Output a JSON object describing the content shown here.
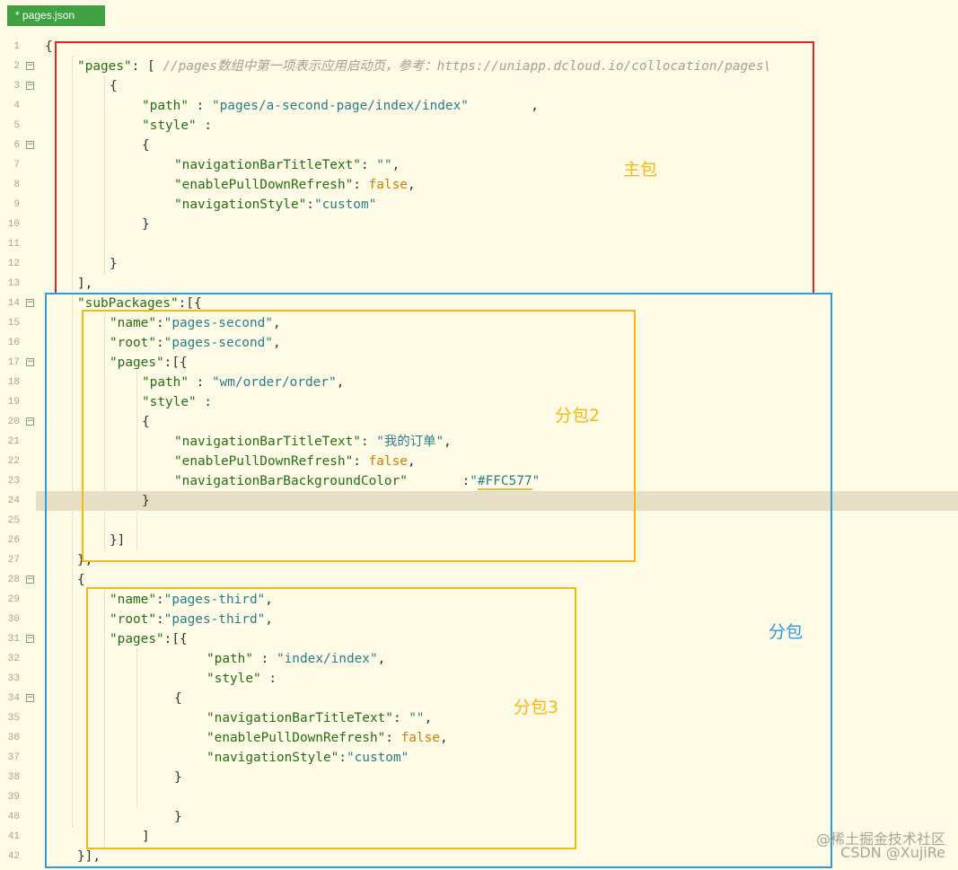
{
  "tab": {
    "title": "* pages.json"
  },
  "lines": [
    {
      "num": "1",
      "fold": false,
      "indent": 0,
      "tokens": [
        {
          "t": "{",
          "c": "p"
        }
      ]
    },
    {
      "num": "2",
      "fold": true,
      "indent": 1,
      "tokens": [
        {
          "t": "\"pages\"",
          "c": "k"
        },
        {
          "t": ": [ ",
          "c": "p"
        },
        {
          "t": "//pages数组中第一项表示应用启动页，参考：https://uniapp.dcloud.io/collocation/pages\\",
          "c": "c"
        }
      ]
    },
    {
      "num": "3",
      "fold": true,
      "indent": 2,
      "tokens": [
        {
          "t": "{",
          "c": "p"
        }
      ]
    },
    {
      "num": "4",
      "fold": false,
      "indent": 3,
      "tokens": [
        {
          "t": "\"path\"",
          "c": "k"
        },
        {
          "t": " : ",
          "c": "p"
        },
        {
          "t": "\"pages/a-second-page/index/index\"",
          "c": "s"
        },
        {
          "t": "        ,",
          "c": "p"
        }
      ]
    },
    {
      "num": "5",
      "fold": false,
      "indent": 3,
      "tokens": [
        {
          "t": "\"style\"",
          "c": "k"
        },
        {
          "t": " :",
          "c": "p"
        }
      ]
    },
    {
      "num": "6",
      "fold": true,
      "indent": 3,
      "tokens": [
        {
          "t": "{",
          "c": "p"
        }
      ]
    },
    {
      "num": "7",
      "fold": false,
      "indent": 4,
      "tokens": [
        {
          "t": "\"navigationBarTitleText\"",
          "c": "k"
        },
        {
          "t": ": ",
          "c": "p"
        },
        {
          "t": "\"\"",
          "c": "s"
        },
        {
          "t": ",",
          "c": "p"
        }
      ]
    },
    {
      "num": "8",
      "fold": false,
      "indent": 4,
      "tokens": [
        {
          "t": "\"enablePullDownRefresh\"",
          "c": "k"
        },
        {
          "t": ": ",
          "c": "p"
        },
        {
          "t": "false",
          "c": "b"
        },
        {
          "t": ",",
          "c": "p"
        }
      ]
    },
    {
      "num": "9",
      "fold": false,
      "indent": 4,
      "tokens": [
        {
          "t": "\"navigationStyle\"",
          "c": "k"
        },
        {
          "t": ":",
          "c": "p"
        },
        {
          "t": "\"custom\"",
          "c": "s"
        }
      ]
    },
    {
      "num": "10",
      "fold": false,
      "indent": 3,
      "tokens": [
        {
          "t": "}",
          "c": "p"
        }
      ]
    },
    {
      "num": "11",
      "fold": false,
      "indent": 0,
      "tokens": []
    },
    {
      "num": "12",
      "fold": false,
      "indent": 2,
      "tokens": [
        {
          "t": "}",
          "c": "p"
        }
      ]
    },
    {
      "num": "13",
      "fold": false,
      "indent": 1,
      "tokens": [
        {
          "t": "],",
          "c": "p"
        }
      ]
    },
    {
      "num": "14",
      "fold": true,
      "indent": 1,
      "tokens": [
        {
          "t": "\"subPackages\"",
          "c": "k"
        },
        {
          "t": ":[{",
          "c": "p"
        }
      ]
    },
    {
      "num": "15",
      "fold": false,
      "indent": 2,
      "tokens": [
        {
          "t": "\"name\"",
          "c": "k"
        },
        {
          "t": ":",
          "c": "p"
        },
        {
          "t": "\"pages-second\"",
          "c": "s"
        },
        {
          "t": ",",
          "c": "p"
        }
      ]
    },
    {
      "num": "16",
      "fold": false,
      "indent": 2,
      "tokens": [
        {
          "t": "\"root\"",
          "c": "k"
        },
        {
          "t": ":",
          "c": "p"
        },
        {
          "t": "\"pages-second\"",
          "c": "s"
        },
        {
          "t": ",",
          "c": "p"
        }
      ]
    },
    {
      "num": "17",
      "fold": true,
      "indent": 2,
      "tokens": [
        {
          "t": "\"pages\"",
          "c": "k"
        },
        {
          "t": ":[{",
          "c": "p"
        }
      ]
    },
    {
      "num": "18",
      "fold": false,
      "indent": 3,
      "tokens": [
        {
          "t": "\"path\"",
          "c": "k"
        },
        {
          "t": " : ",
          "c": "p"
        },
        {
          "t": "\"wm/order/order\"",
          "c": "s"
        },
        {
          "t": ",",
          "c": "p"
        }
      ]
    },
    {
      "num": "19",
      "fold": false,
      "indent": 3,
      "tokens": [
        {
          "t": "\"style\"",
          "c": "k"
        },
        {
          "t": " :",
          "c": "p"
        }
      ]
    },
    {
      "num": "20",
      "fold": true,
      "indent": 3,
      "tokens": [
        {
          "t": "{",
          "c": "p"
        }
      ]
    },
    {
      "num": "21",
      "fold": false,
      "indent": 4,
      "tokens": [
        {
          "t": "\"navigationBarTitleText\"",
          "c": "k"
        },
        {
          "t": ": ",
          "c": "p"
        },
        {
          "t": "\"我的订单\"",
          "c": "s"
        },
        {
          "t": ",",
          "c": "p"
        }
      ]
    },
    {
      "num": "22",
      "fold": false,
      "indent": 4,
      "tokens": [
        {
          "t": "\"enablePullDownRefresh\"",
          "c": "k"
        },
        {
          "t": ": ",
          "c": "p"
        },
        {
          "t": "false",
          "c": "b"
        },
        {
          "t": ",",
          "c": "p"
        }
      ]
    },
    {
      "num": "23",
      "fold": false,
      "indent": 4,
      "tokens": [
        {
          "t": "\"navigationBarBackgroundColor\"",
          "c": "k"
        },
        {
          "t": "       :",
          "c": "p"
        },
        {
          "t": "\"",
          "c": "s"
        },
        {
          "t": "#FFC577",
          "c": "hl"
        },
        {
          "t": "\"",
          "c": "s"
        }
      ]
    },
    {
      "num": "24",
      "fold": false,
      "indent": 3,
      "active": true,
      "tokens": [
        {
          "t": "}",
          "c": "p"
        }
      ]
    },
    {
      "num": "25",
      "fold": false,
      "indent": 0,
      "tokens": []
    },
    {
      "num": "26",
      "fold": false,
      "indent": 2,
      "tokens": [
        {
          "t": "}]",
          "c": "p"
        }
      ]
    },
    {
      "num": "27",
      "fold": false,
      "indent": 1,
      "tokens": [
        {
          "t": "},",
          "c": "p"
        }
      ]
    },
    {
      "num": "28",
      "fold": true,
      "indent": 1,
      "tokens": [
        {
          "t": "{",
          "c": "p"
        }
      ]
    },
    {
      "num": "29",
      "fold": false,
      "indent": 2,
      "tokens": [
        {
          "t": "\"name\"",
          "c": "k"
        },
        {
          "t": ":",
          "c": "p"
        },
        {
          "t": "\"pages-third\"",
          "c": "s"
        },
        {
          "t": ",",
          "c": "p"
        }
      ]
    },
    {
      "num": "30",
      "fold": false,
      "indent": 2,
      "tokens": [
        {
          "t": "\"root\"",
          "c": "k"
        },
        {
          "t": ":",
          "c": "p"
        },
        {
          "t": "\"pages-third\"",
          "c": "s"
        },
        {
          "t": ",",
          "c": "p"
        }
      ]
    },
    {
      "num": "31",
      "fold": true,
      "indent": 2,
      "tokens": [
        {
          "t": "\"pages\"",
          "c": "k"
        },
        {
          "t": ":[{",
          "c": "p"
        }
      ]
    },
    {
      "num": "32",
      "fold": false,
      "indent": 5,
      "tokens": [
        {
          "t": "\"path\"",
          "c": "k"
        },
        {
          "t": " : ",
          "c": "p"
        },
        {
          "t": "\"index/index\"",
          "c": "s"
        },
        {
          "t": ",",
          "c": "p"
        }
      ]
    },
    {
      "num": "33",
      "fold": false,
      "indent": 5,
      "tokens": [
        {
          "t": "\"style\"",
          "c": "k"
        },
        {
          "t": " :",
          "c": "p"
        }
      ]
    },
    {
      "num": "34",
      "fold": true,
      "indent": 4,
      "tokens": [
        {
          "t": "{",
          "c": "p"
        }
      ]
    },
    {
      "num": "35",
      "fold": false,
      "indent": 5,
      "tokens": [
        {
          "t": "\"navigationBarTitleText\"",
          "c": "k"
        },
        {
          "t": ": ",
          "c": "p"
        },
        {
          "t": "\"\"",
          "c": "s"
        },
        {
          "t": ",",
          "c": "p"
        }
      ]
    },
    {
      "num": "36",
      "fold": false,
      "indent": 5,
      "tokens": [
        {
          "t": "\"enablePullDownRefresh\"",
          "c": "k"
        },
        {
          "t": ": ",
          "c": "p"
        },
        {
          "t": "false",
          "c": "b"
        },
        {
          "t": ",",
          "c": "p"
        }
      ]
    },
    {
      "num": "37",
      "fold": false,
      "indent": 5,
      "tokens": [
        {
          "t": "\"navigationStyle\"",
          "c": "k"
        },
        {
          "t": ":",
          "c": "p"
        },
        {
          "t": "\"custom\"",
          "c": "s"
        }
      ]
    },
    {
      "num": "38",
      "fold": false,
      "indent": 4,
      "tokens": [
        {
          "t": "}",
          "c": "p"
        }
      ]
    },
    {
      "num": "39",
      "fold": false,
      "indent": 0,
      "tokens": []
    },
    {
      "num": "40",
      "fold": false,
      "indent": 4,
      "tokens": [
        {
          "t": "}",
          "c": "p"
        }
      ]
    },
    {
      "num": "41",
      "fold": false,
      "indent": 3,
      "tokens": [
        {
          "t": "]",
          "c": "p"
        }
      ]
    },
    {
      "num": "42",
      "fold": false,
      "indent": 1,
      "tokens": [
        {
          "t": "}],",
          "c": "p"
        }
      ]
    }
  ],
  "annotations": {
    "main": {
      "label": "主包",
      "color": "#e5261f"
    },
    "subpackages": {
      "label": "分包",
      "color": "#2b9be4"
    },
    "sub2": {
      "label": "分包2",
      "color": "#f3b813"
    },
    "sub3": {
      "label": "分包3",
      "color": "#f3b813"
    }
  },
  "watermark": {
    "line1": "@稀土掘金技术社区",
    "line2": "CSDN @XujiRe"
  }
}
